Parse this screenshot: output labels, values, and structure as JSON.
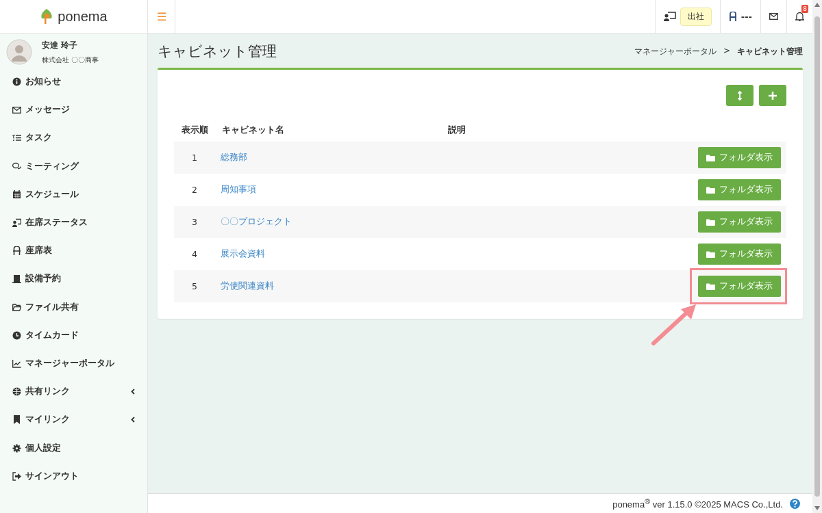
{
  "header": {
    "logo": "ponema",
    "menu_toggle": "☰",
    "attendance_status": "出社",
    "seat": "---",
    "notification_count": "8"
  },
  "user": {
    "name": "安達 玲子",
    "company": "株式会社 〇〇商事"
  },
  "sidebar": {
    "items": [
      {
        "label": "お知らせ",
        "has_submenu": false
      },
      {
        "label": "メッセージ",
        "has_submenu": false
      },
      {
        "label": "タスク",
        "has_submenu": false
      },
      {
        "label": "ミーティング",
        "has_submenu": false
      },
      {
        "label": "スケジュール",
        "has_submenu": false
      },
      {
        "label": "在席ステータス",
        "has_submenu": false
      },
      {
        "label": "座席表",
        "has_submenu": false
      },
      {
        "label": "設備予約",
        "has_submenu": false
      },
      {
        "label": "ファイル共有",
        "has_submenu": false
      },
      {
        "label": "タイムカード",
        "has_submenu": false
      },
      {
        "label": "マネージャーポータル",
        "has_submenu": false
      },
      {
        "label": "共有リンク",
        "has_submenu": true
      },
      {
        "label": "マイリンク",
        "has_submenu": true
      },
      {
        "label": "個人設定",
        "has_submenu": false
      },
      {
        "label": "サインアウト",
        "has_submenu": false
      }
    ]
  },
  "page": {
    "title": "キャビネット管理",
    "breadcrumb": [
      {
        "label": "マネージャーポータル",
        "current": false
      },
      {
        "label": "キャビネット管理",
        "current": true
      }
    ],
    "breadcrumb_separator": ">"
  },
  "table": {
    "columns": [
      "表示順",
      "キャビネット名",
      "説明"
    ],
    "rows": [
      {
        "order": "1",
        "name": "総務部",
        "action": "フォルダ表示",
        "highlighted": false
      },
      {
        "order": "2",
        "name": "周知事項",
        "action": "フォルダ表示",
        "highlighted": false
      },
      {
        "order": "3",
        "name": "〇〇プロジェクト",
        "action": "フォルダ表示",
        "highlighted": false
      },
      {
        "order": "4",
        "name": "展示会資料",
        "action": "フォルダ表示",
        "highlighted": false
      },
      {
        "order": "5",
        "name": "労使関連資料",
        "action": "フォルダ表示",
        "highlighted": true
      }
    ]
  },
  "footer": {
    "text": "ponema$^{®}$ ver 1.15.0 ©2025 MACS Co.,Ltd."
  }
}
